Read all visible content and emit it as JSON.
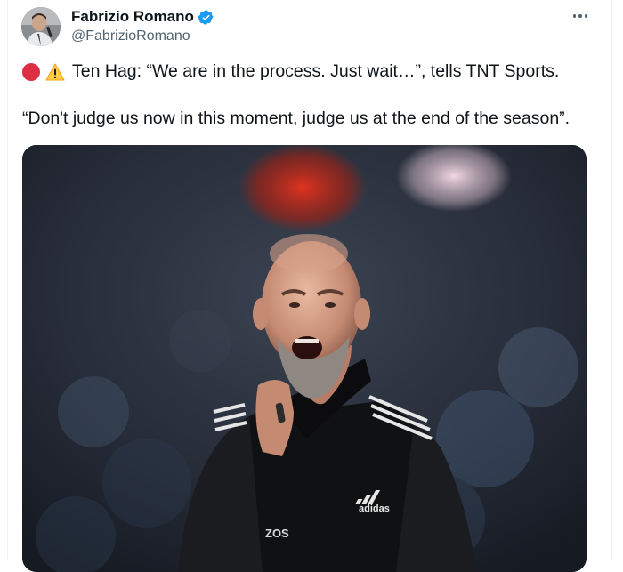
{
  "tweet": {
    "author_name": "Fabrizio Romano",
    "author_handle": "@FabrizioRomano",
    "line1_text": "Ten Hag: “We are in the process. Just wait…”, tells TNT Sports.",
    "line2_text": "“Don't judge us now in this moment, judge us at the end of the season”.",
    "icons": [
      "red-circle-icon",
      "warning-icon",
      "verified-badge-icon",
      "more-options-icon"
    ]
  },
  "media": {
    "jacket_brand": "adidas",
    "jacket_text": "ZOS"
  },
  "colors": {
    "text": "#0f1419",
    "secondary": "#536471",
    "verified": "#1d9bf0",
    "red_dot": "#dd2e44",
    "warning": "#ffcc4d"
  }
}
